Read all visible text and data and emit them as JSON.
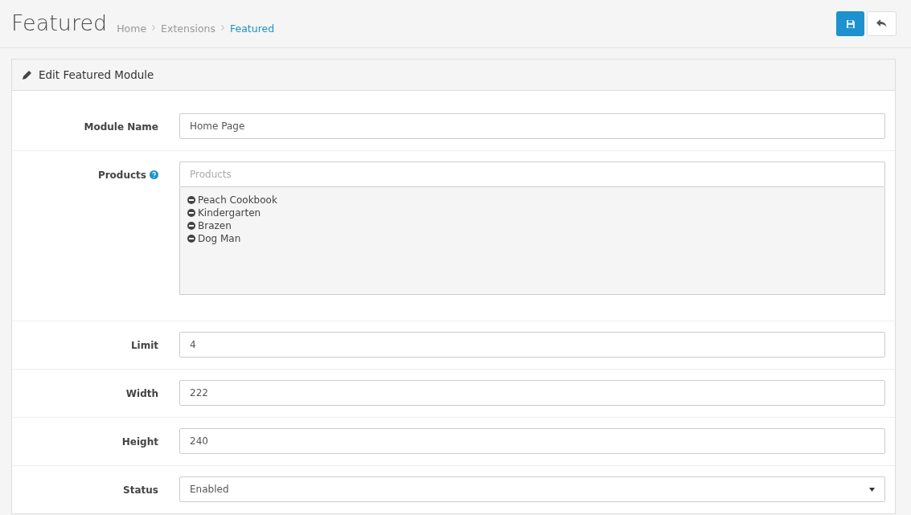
{
  "header": {
    "title": "Featured",
    "breadcrumb": [
      {
        "label": "Home",
        "selected": false
      },
      {
        "label": "Extensions",
        "selected": false
      },
      {
        "label": "Featured",
        "selected": true
      }
    ]
  },
  "panel": {
    "title": "Edit Featured Module",
    "fields": [
      {
        "kind": "text",
        "label": "Module Name",
        "value": "Home Page"
      },
      {
        "kind": "autocomplete",
        "label": "Products",
        "placeholder": "Products",
        "items": [
          "Peach Cookbook",
          "Kindergarten",
          "Brazen",
          "Dog Man"
        ]
      },
      {
        "kind": "text",
        "label": "Limit",
        "value": "4"
      },
      {
        "kind": "text",
        "label": "Width",
        "value": "222"
      },
      {
        "kind": "text",
        "label": "Height",
        "value": "240"
      },
      {
        "kind": "select",
        "label": "Status",
        "value": "Enabled"
      }
    ]
  }
}
